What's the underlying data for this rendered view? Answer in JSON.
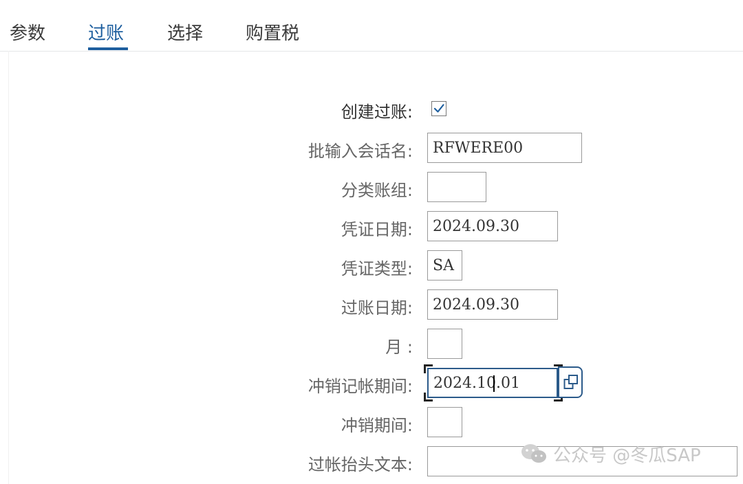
{
  "tabs": [
    {
      "label": "参数",
      "active": false
    },
    {
      "label": "过账",
      "active": true
    },
    {
      "label": "选择",
      "active": false
    },
    {
      "label": "购置税",
      "active": false
    }
  ],
  "form": {
    "create_posting": {
      "label": "创建过账:",
      "checked": true
    },
    "batch_session": {
      "label": "批输入会话名:",
      "value": "RFWERE00"
    },
    "ledger_group": {
      "label": "分类账组:",
      "value": ""
    },
    "document_date": {
      "label": "凭证日期:",
      "value": "2024.09.30"
    },
    "document_type": {
      "label": "凭证类型:",
      "value": "SA"
    },
    "posting_date": {
      "label": "过账日期:",
      "value": "2024.09.30"
    },
    "month": {
      "label": "月 :",
      "value": ""
    },
    "reversal_posting_period": {
      "label": "冲销记帐期间:",
      "value": "2024.10.01"
    },
    "reversal_period": {
      "label": "冲销期间:",
      "value": ""
    },
    "header_text": {
      "label": "过帐抬头文本:",
      "value": ""
    }
  },
  "watermark": {
    "text": "公众号 @冬瓜SAP",
    "icon": "wechat-icon"
  },
  "colors": {
    "accent": "#1d5e9e",
    "field_border": "#999999"
  }
}
